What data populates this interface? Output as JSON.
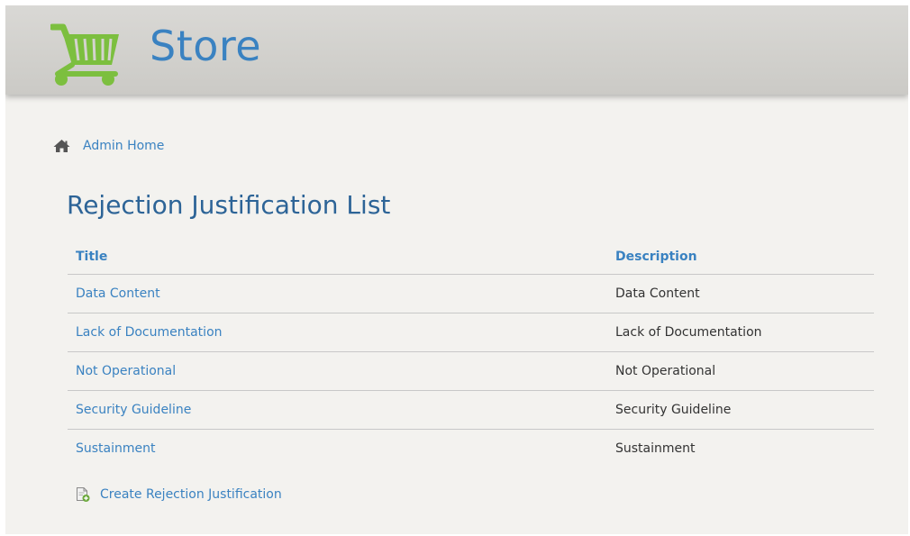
{
  "header": {
    "logo_text": "Store",
    "logo_icon": "shopping-cart-icon"
  },
  "breadcrumb": {
    "home_icon": "home-icon",
    "home_label": "Admin Home"
  },
  "page": {
    "title": "Rejection Justification List"
  },
  "table": {
    "columns": [
      "Title",
      "Description"
    ],
    "rows": [
      {
        "title": "Data Content",
        "description": "Data Content"
      },
      {
        "title": "Lack of Documentation",
        "description": "Lack of Documentation"
      },
      {
        "title": "Not Operational",
        "description": "Not Operational"
      },
      {
        "title": "Security Guideline",
        "description": "Security Guideline"
      },
      {
        "title": "Sustainment",
        "description": "Sustainment"
      }
    ]
  },
  "actions": {
    "create_icon": "document-add-icon",
    "create_label": "Create Rejection Justification"
  },
  "colors": {
    "accent": "#3a82c1",
    "title": "#2d6497",
    "cart_green": "#7cbf3f"
  }
}
